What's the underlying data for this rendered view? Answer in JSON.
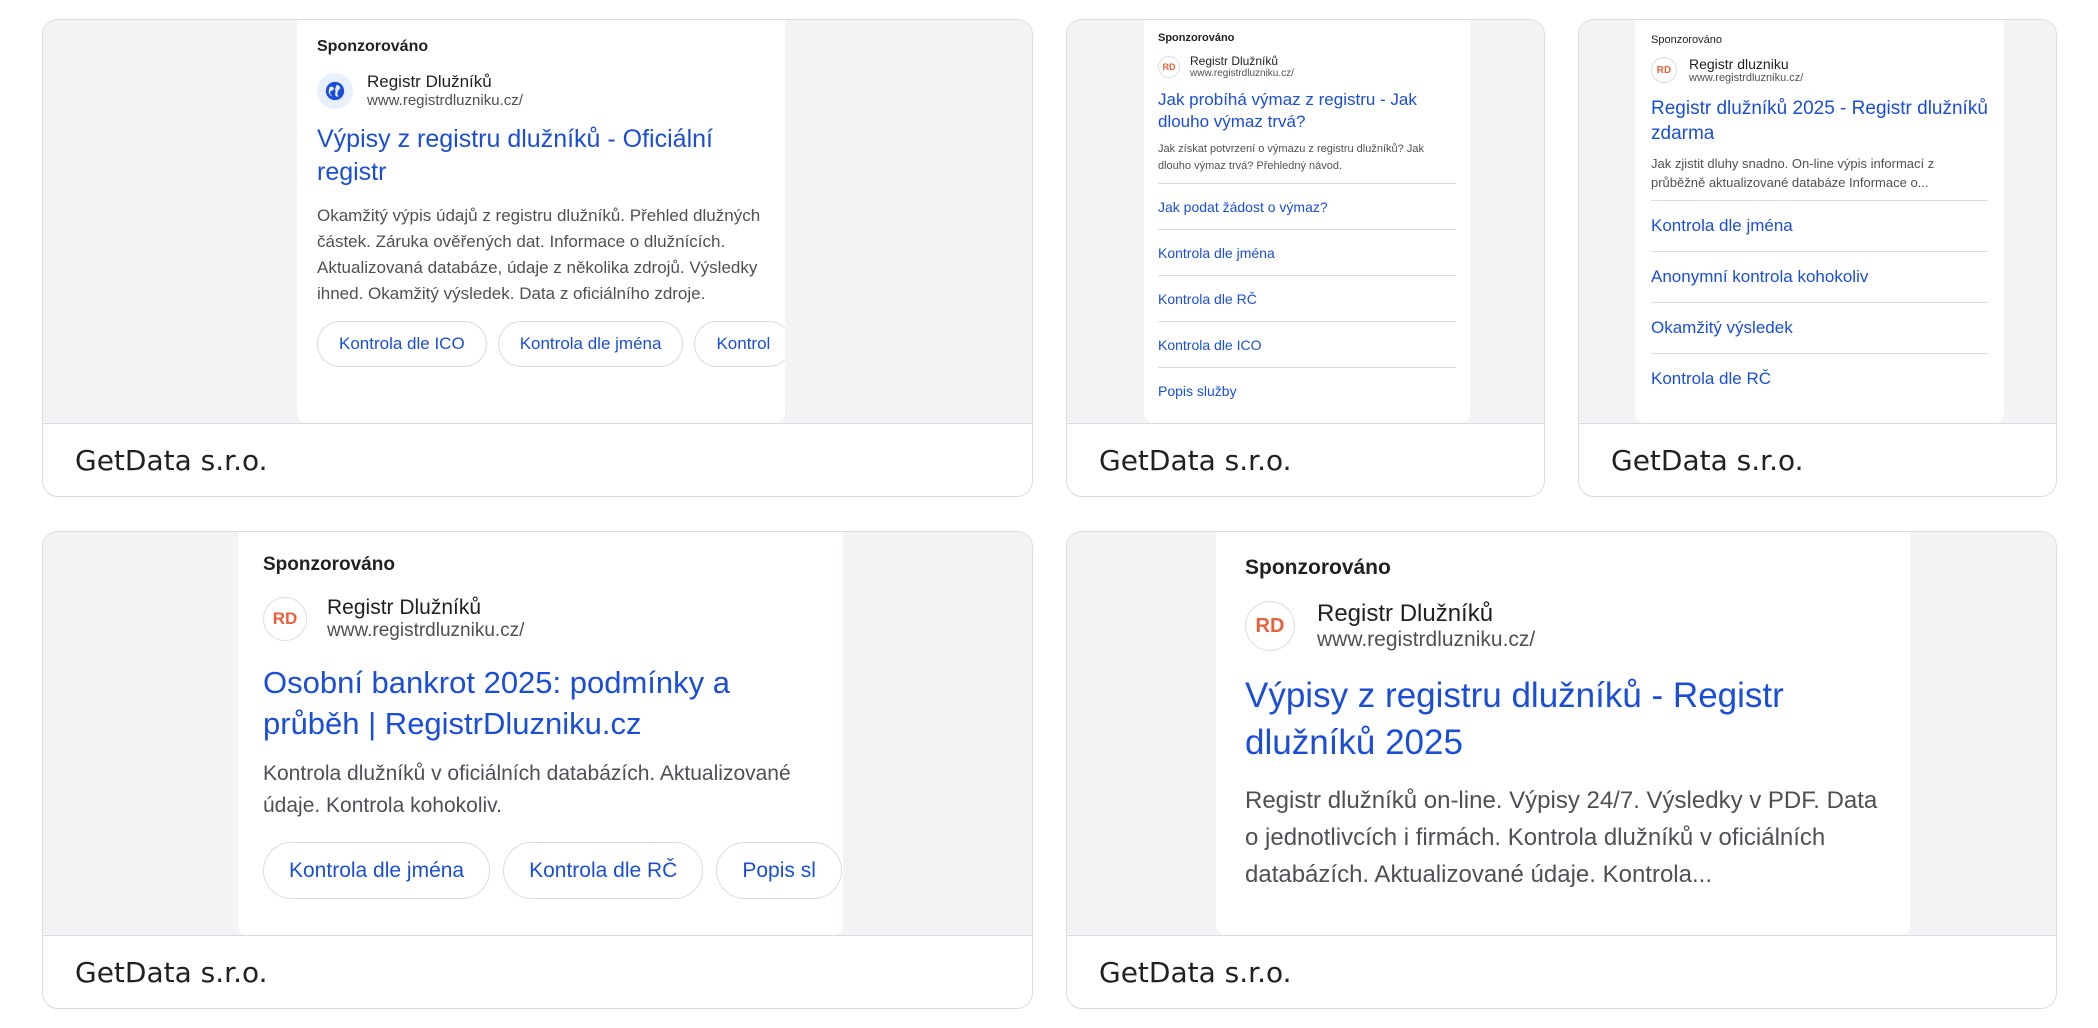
{
  "advertiser": "GetData s.r.o.",
  "ads": [
    {
      "sponsored": "Sponzorováno",
      "brand_name": "Registr Dlužníků",
      "brand_url": "www.registrdluzniku.cz/",
      "logo_icon": "globe-icon",
      "headline": "Výpisy z registru dlužníků - Oficiální registr",
      "description": "Okamžitý výpis údajů z registru dlužníků. Přehled dlužných částek. Záruka ověřených dat. Informace o dlužnících. Aktualizovaná databáze, údaje z několika zdrojů. Výsledky ihned. Okamžitý výsledek. Data z oficiálního zdroje.",
      "chips": [
        "Kontrola dle ICO",
        "Kontrola dle jména",
        "Kontrol"
      ],
      "advertiser": "GetData s.r.o."
    },
    {
      "sponsored": "Sponzorováno",
      "logo_text": "RD",
      "brand_name": "Registr Dlužníků",
      "brand_url": "www.registrdluzniku.cz/",
      "headline": "Jak probíhá výmaz z registru - Jak dlouho výmaz trvá?",
      "description": "Jak získat potvrzení o výmazu z registru dlužníků? Jak dlouho výmaz trvá? Přehledný návod.",
      "sitelinks": [
        "Jak podat žádost o výmaz?",
        "Kontrola dle jména",
        "Kontrola dle RČ",
        "Kontrola dle ICO",
        "Popis služby"
      ],
      "advertiser": "GetData s.r.o."
    },
    {
      "sponsored": "Sponzorováno",
      "logo_text": "RD",
      "brand_name": "Registr dluzniku",
      "brand_url": "www.registrdluzniku.cz/",
      "headline": "Registr dlužníků 2025 - Registr dlužníků zdarma",
      "description": "Jak zjistit dluhy snadno. On-line výpis informací z průběžně aktualizované databáze Informace o...",
      "sitelinks": [
        "Kontrola dle jména",
        "Anonymní kontrola kohokoliv",
        "Okamžitý výsledek",
        "Kontrola dle RČ"
      ],
      "advertiser": "GetData s.r.o."
    },
    {
      "sponsored": "Sponzorováno",
      "logo_text": "RD",
      "brand_name": "Registr Dlužníků",
      "brand_url": "www.registrdluzniku.cz/",
      "headline": "Osobní bankrot 2025: podmínky a průběh | RegistrDluzniku.cz",
      "description": "Kontrola dlužníků v oficiálních databázích. Aktualizované údaje. Kontrola kohokoliv.",
      "chips": [
        "Kontrola dle jména",
        "Kontrola dle RČ",
        "Popis sl"
      ],
      "advertiser": "GetData s.r.o."
    },
    {
      "sponsored": "Sponzorováno",
      "logo_text": "RD",
      "brand_name": "Registr Dlužníků",
      "brand_url": "www.registrdluzniku.cz/",
      "headline": "Výpisy z registru dlužníků - Registr dlužníků 2025",
      "description": "Registr dlužníků on-line. Výpisy 24/7. Výsledky v PDF. Data o jednotlivcích i firmách. Kontrola dlužníků v oficiálních databázích. Aktualizované údaje. Kontrola...",
      "advertiser": "GetData s.r.o."
    }
  ]
}
